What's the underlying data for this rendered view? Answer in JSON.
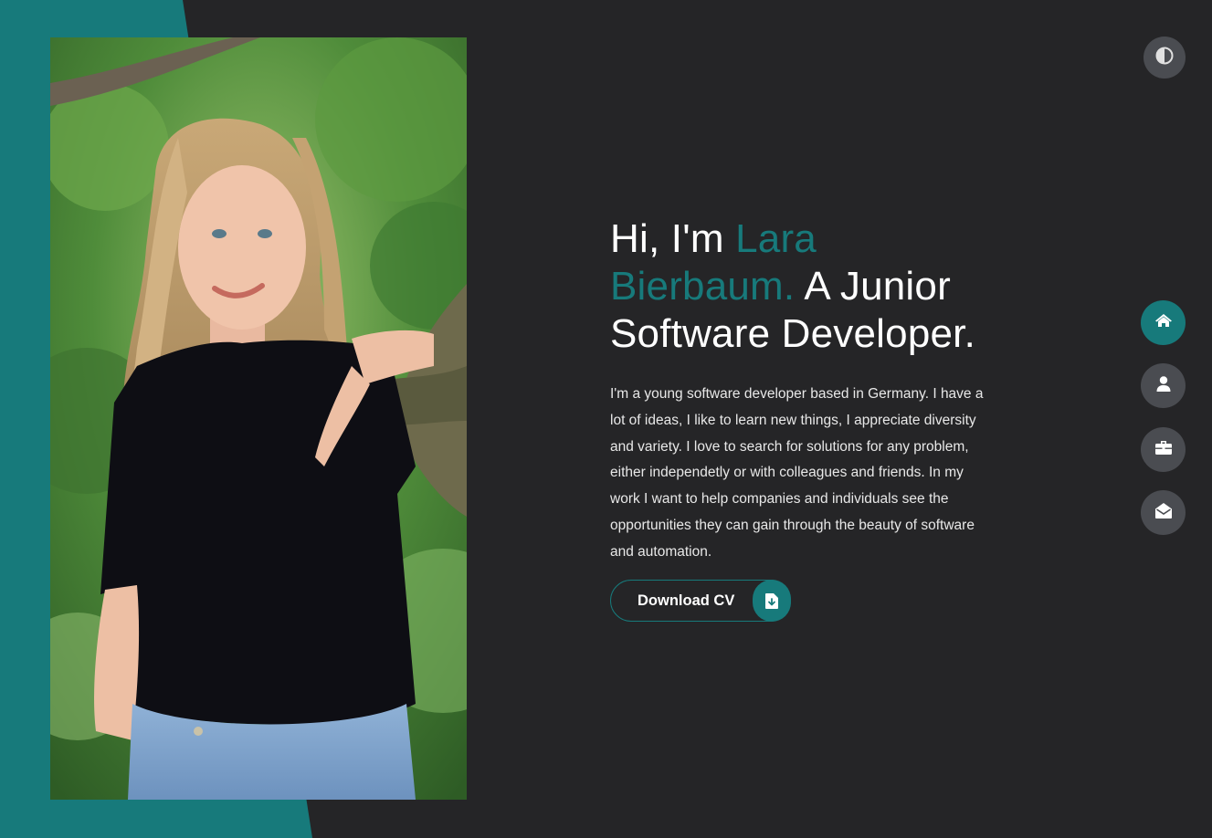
{
  "colors": {
    "background": "#252527",
    "accent": "#177a7b",
    "nav_inactive": "#4a4c51",
    "text": "#ffffff"
  },
  "hero": {
    "greeting": "Hi, I'm ",
    "name": "Lara Bierbaum.",
    "title": " A Junior Software Developer.",
    "bio": "I'm a young software developer based in Germany. I have a lot of ideas, I like to learn new things, I appreciate diversity and variety. I love to search for solutions for any problem, either independetly or with colleagues and friends. In my work I want to help companies and individuals see the opportunities they can gain through the beauty of software and automation."
  },
  "cv_button": {
    "label": "Download CV",
    "icon": "file-download-icon"
  },
  "theme_toggle": {
    "icon": "contrast-icon"
  },
  "nav": [
    {
      "id": "home",
      "icon": "home-icon",
      "active": true
    },
    {
      "id": "about",
      "icon": "user-icon",
      "active": false
    },
    {
      "id": "portfolio",
      "icon": "briefcase-icon",
      "active": false
    },
    {
      "id": "contact",
      "icon": "envelope-open-icon",
      "active": false
    }
  ],
  "photo": {
    "subject": "portrait-photo"
  }
}
